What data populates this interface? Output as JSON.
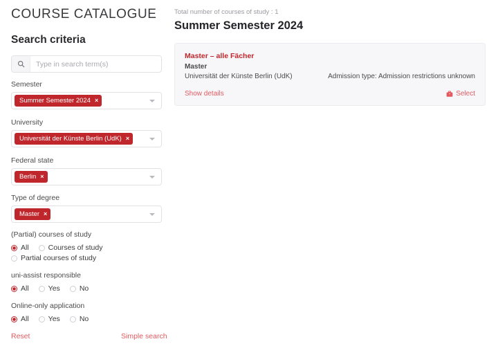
{
  "app": {
    "title": "COURSE CATALOGUE"
  },
  "sidebar": {
    "section_title": "Search criteria",
    "search": {
      "icon": "search-icon",
      "value": "",
      "placeholder": "Type in search term(s)"
    },
    "filters": [
      {
        "label": "Semester",
        "chips": [
          {
            "text": "Summer Semester 2024",
            "remove": "×"
          }
        ],
        "caret": "chevron-down-icon"
      },
      {
        "label": "University",
        "chips": [
          {
            "text": "Universität der Künste Berlin (UdK)",
            "remove": "×"
          }
        ],
        "caret": "chevron-down-icon"
      },
      {
        "label": "Federal state",
        "chips": [
          {
            "text": "Berlin",
            "remove": "×"
          }
        ],
        "caret": "chevron-down-icon"
      },
      {
        "label": "Type of degree",
        "chips": [
          {
            "text": "Master",
            "remove": "×"
          }
        ],
        "caret": "chevron-down-icon"
      }
    ],
    "radio_groups": [
      {
        "label": "(Partial) courses of study",
        "row1": [
          {
            "label": "All",
            "checked": true
          },
          {
            "label": "Courses of study",
            "checked": false
          }
        ],
        "row2": [
          {
            "label": "Partial courses of study",
            "checked": false
          }
        ]
      },
      {
        "label": "uni-assist responsible",
        "row1": [
          {
            "label": "All",
            "checked": true
          },
          {
            "label": "Yes",
            "checked": false
          },
          {
            "label": "No",
            "checked": false
          }
        ]
      },
      {
        "label": "Online-only application",
        "row1": [
          {
            "label": "All",
            "checked": true
          },
          {
            "label": "Yes",
            "checked": false
          },
          {
            "label": "No",
            "checked": false
          }
        ]
      }
    ],
    "footer": {
      "reset_label": "Reset",
      "simple_search_label": "Simple search"
    }
  },
  "main": {
    "total_count_text": "Total number of courses of study : 1",
    "semester_heading": "Summer Semester 2024",
    "results": [
      {
        "title": "Master – alle Fächer",
        "degree": "Master",
        "university": "Universität der Künste Berlin (UdK)",
        "admission": "Admission type: Admission restrictions unknown",
        "show_details_label": "Show details",
        "select_label": "Select",
        "select_icon": "briefcase-icon"
      }
    ]
  },
  "colors": {
    "brand_red": "#c0272d",
    "link_red": "#e05a60",
    "card_bg": "#f7f7f9",
    "card_border": "#ececf0",
    "text": "#3a3a3c",
    "muted": "#9b9ba1"
  }
}
